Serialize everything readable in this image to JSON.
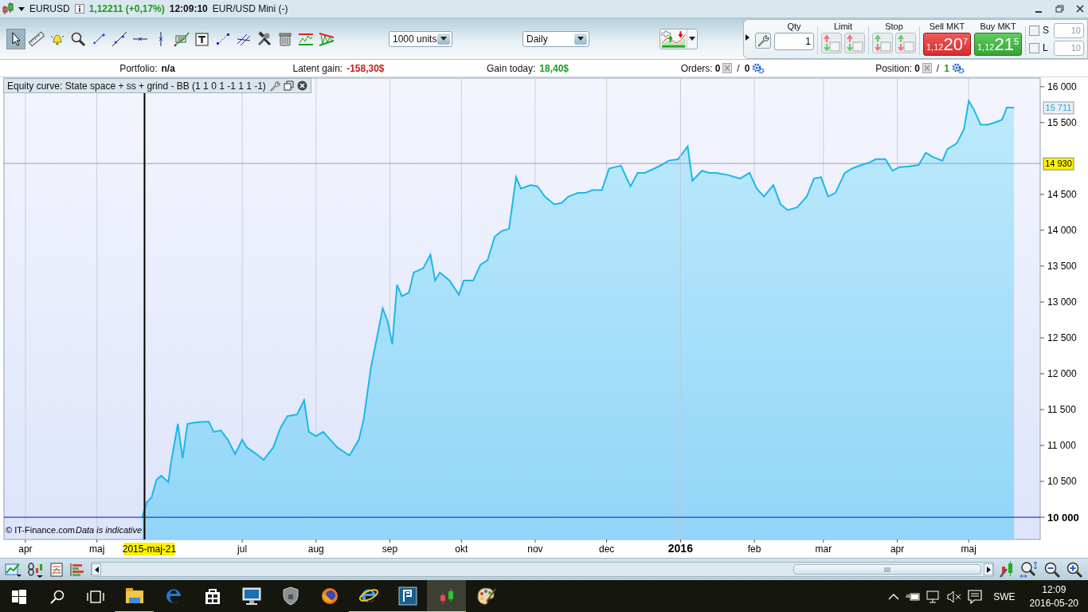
{
  "title_bar": {
    "symbol": "EURUSD",
    "price": "1,12211 (+0,17%)",
    "time": "12:09:10",
    "instrument": "EUR/USD Mini (-)"
  },
  "tools": [
    {
      "selected": true
    },
    {
      "selected": false
    },
    {
      "selected": false
    },
    {
      "selected": false
    },
    {
      "selected": false
    },
    {
      "selected": false
    },
    {
      "selected": false
    },
    {
      "selected": false
    },
    {
      "selected": false
    },
    {
      "selected": false
    },
    {
      "selected": false
    },
    {
      "selected": false
    },
    {
      "selected": false
    },
    {
      "selected": false
    },
    {
      "selected": false
    },
    {
      "selected": false
    }
  ],
  "quantity_select": {
    "value": "1000 units"
  },
  "period_select": {
    "value": "Daily"
  },
  "order_panel": {
    "qty_label": "Qty",
    "qty_value": "1",
    "limit_label": "Limit",
    "stop_label": "Stop",
    "sell": {
      "label": "Sell MKT",
      "price_prefix": "1,12",
      "price_big": "20",
      "price_pip": "7"
    },
    "buy": {
      "label": "Buy MKT",
      "price_prefix": "1,12",
      "price_big": "21",
      "price_pip": "5"
    },
    "options": [
      {
        "label": "S",
        "checked": false,
        "value": "10",
        "disabled": true
      },
      {
        "label": "L",
        "checked": false,
        "value": "10",
        "disabled": true
      }
    ]
  },
  "info_bar": [
    {
      "label": "Portfolio:",
      "value": "n/a",
      "kind": "plain"
    },
    {
      "label": "Latent gain:",
      "value": "-158,30$",
      "kind": "loss"
    },
    {
      "label": "Gain today:",
      "value": "18,40$",
      "kind": "gain"
    }
  ],
  "counters": [
    {
      "label": "Orders:",
      "first": "0",
      "separator": "/",
      "second": "0",
      "second_positive": false
    },
    {
      "label": "Position:",
      "first": "0",
      "separator": "/",
      "second": "1",
      "second_positive": true
    }
  ],
  "chart": {
    "footer": "© IT-Finance.com",
    "footer_note": "Data is indicative",
    "chart_data": {
      "type": "area",
      "title": "Equity curve: State space + ss + grind - BB (1 1 0 1 -1 1 1 -1)",
      "x": [
        "2015-05-20",
        "2015-05-22",
        "2015-05-24",
        "2015-05-26",
        "2015-05-28",
        "2015-05-31",
        "2015-06-01",
        "2015-06-04",
        "2015-06-06",
        "2015-06-08",
        "2015-06-11",
        "2015-06-15",
        "2015-06-17",
        "2015-06-19",
        "2015-06-22",
        "2015-06-25",
        "2015-06-28",
        "2015-07-01",
        "2015-07-03",
        "2015-07-07",
        "2015-07-10",
        "2015-07-14",
        "2015-07-17",
        "2015-07-20",
        "2015-07-24",
        "2015-07-27",
        "2015-07-29",
        "2015-08-01",
        "2015-08-04",
        "2015-08-07",
        "2015-08-10",
        "2015-08-15",
        "2015-08-19",
        "2015-08-21",
        "2015-08-24",
        "2015-08-26",
        "2015-08-29",
        "2015-08-31",
        "2015-09-02",
        "2015-09-04",
        "2015-09-06",
        "2015-09-09",
        "2015-09-11",
        "2015-09-15",
        "2015-09-18",
        "2015-09-20",
        "2015-09-22",
        "2015-09-26",
        "2015-09-30",
        "2015-10-02",
        "2015-10-06",
        "2015-10-09",
        "2015-10-12",
        "2015-10-15",
        "2015-10-18",
        "2015-10-21",
        "2015-10-24",
        "2015-10-26",
        "2015-10-30",
        "2015-11-02",
        "2015-11-05",
        "2015-11-09",
        "2015-11-12",
        "2015-11-15",
        "2015-11-19",
        "2015-11-22",
        "2015-11-25",
        "2015-11-29",
        "2015-12-02",
        "2015-12-07",
        "2015-12-11",
        "2015-12-14",
        "2015-12-17",
        "2015-12-21",
        "2015-12-24",
        "2015-12-27",
        "2015-12-31",
        "2016-01-04",
        "2016-01-06",
        "2016-01-10",
        "2016-01-13",
        "2016-01-16",
        "2016-01-21",
        "2016-01-26",
        "2016-01-30",
        "2016-02-02",
        "2016-02-05",
        "2016-02-09",
        "2016-02-12",
        "2016-02-15",
        "2016-02-19",
        "2016-02-23",
        "2016-02-26",
        "2016-02-29",
        "2016-03-03",
        "2016-03-06",
        "2016-03-10",
        "2016-03-13",
        "2016-03-17",
        "2016-03-20",
        "2016-03-23",
        "2016-03-27",
        "2016-03-30",
        "2016-04-02",
        "2016-04-06",
        "2016-04-10",
        "2016-04-13",
        "2016-04-16",
        "2016-04-20",
        "2016-04-22",
        "2016-04-26",
        "2016-04-29",
        "2016-05-01",
        "2016-05-03",
        "2016-05-06",
        "2016-05-09",
        "2016-05-12",
        "2016-05-15",
        "2016-05-17",
        "2016-05-20"
      ],
      "series": [
        {
          "color": "#1ab8ea",
          "values": [
            10000,
            10210,
            10280,
            10520,
            10580,
            10490,
            10740,
            11300,
            10820,
            11300,
            11320,
            11330,
            11330,
            11190,
            11210,
            11080,
            10880,
            11080,
            10970,
            10880,
            10800,
            10970,
            11240,
            11410,
            11430,
            11630,
            11190,
            11130,
            11190,
            11080,
            10970,
            10860,
            11080,
            11360,
            12080,
            12410,
            12910,
            12740,
            12410,
            13240,
            13080,
            13130,
            13410,
            13470,
            13660,
            13300,
            13410,
            13300,
            13100,
            13300,
            13300,
            13520,
            13580,
            13910,
            13990,
            14020,
            14740,
            14580,
            14630,
            14610,
            14470,
            14360,
            14380,
            14470,
            14520,
            14520,
            14560,
            14560,
            14860,
            14900,
            14610,
            14800,
            14800,
            14860,
            14910,
            14970,
            14990,
            15170,
            14690,
            14830,
            14800,
            14800,
            14770,
            14720,
            14800,
            14580,
            14470,
            14630,
            14360,
            14280,
            14320,
            14470,
            14720,
            14740,
            14470,
            14520,
            14800,
            14860,
            14910,
            14940,
            14990,
            14990,
            14830,
            14880,
            14890,
            14910,
            15080,
            15020,
            14970,
            15130,
            15210,
            15410,
            15800,
            15690,
            15470,
            15470,
            15500,
            15540,
            15710,
            15710
          ]
        }
      ],
      "grid": true,
      "xlim": [
        "2015-03-23",
        "2016-05-31"
      ],
      "ylim": [
        9690,
        16120
      ],
      "xticks": [
        {
          "value": "2015-04-01",
          "label": "apr"
        },
        {
          "value": "2015-05-01",
          "label": "maj"
        },
        {
          "value": "2015-07-01",
          "label": "jul"
        },
        {
          "value": "2015-08-01",
          "label": "aug"
        },
        {
          "value": "2015-09-01",
          "label": "sep"
        },
        {
          "value": "2015-10-01",
          "label": "okt"
        },
        {
          "value": "2015-11-01",
          "label": "nov"
        },
        {
          "value": "2015-12-01",
          "label": "dec"
        },
        {
          "value": "2016-02-01",
          "label": "feb"
        },
        {
          "value": "2016-03-01",
          "label": "mar"
        },
        {
          "value": "2016-04-01",
          "label": "apr"
        },
        {
          "value": "2016-05-01",
          "label": "maj"
        }
      ],
      "yticks": [
        {
          "value": 10500,
          "label": "10 500"
        },
        {
          "value": 11000,
          "label": "11 000"
        },
        {
          "value": 11500,
          "label": "11 500"
        },
        {
          "value": 12000,
          "label": "12 000"
        },
        {
          "value": 12500,
          "label": "12 500"
        },
        {
          "value": 13000,
          "label": "13 000"
        },
        {
          "value": 13500,
          "label": "13 500"
        },
        {
          "value": 14000,
          "label": "14 000"
        },
        {
          "value": 14500,
          "label": "14 500"
        },
        {
          "value": 15500,
          "label": "15 500"
        },
        {
          "value": 16000,
          "label": "16 000"
        }
      ],
      "annotations": [
        {
          "x": "2016-01-01",
          "text": "2016"
        },
        "15 711"
      ],
      "ref_lines": [
        {
          "axis": "y",
          "value": 10000,
          "label": "10 000"
        },
        {
          "axis": "y",
          "value": 14930,
          "label": "14 930"
        },
        {
          "axis": "x",
          "value": "2015-05-21",
          "label": "2015-maj-21"
        }
      ]
    }
  },
  "taskbar": {
    "apps": [
      {
        "running": true,
        "selected": false
      },
      {
        "running": false,
        "selected": false
      },
      {
        "running": false,
        "selected": false
      },
      {
        "running": false,
        "selected": false
      },
      {
        "running": false,
        "selected": false
      },
      {
        "running": false,
        "selected": false
      },
      {
        "running": true,
        "selected": false
      },
      {
        "running": true,
        "selected": false
      },
      {
        "running": true,
        "selected": true
      },
      {
        "running": false,
        "selected": false
      }
    ],
    "language": "SWE",
    "time": "12:09",
    "date": "2016-05-20"
  }
}
